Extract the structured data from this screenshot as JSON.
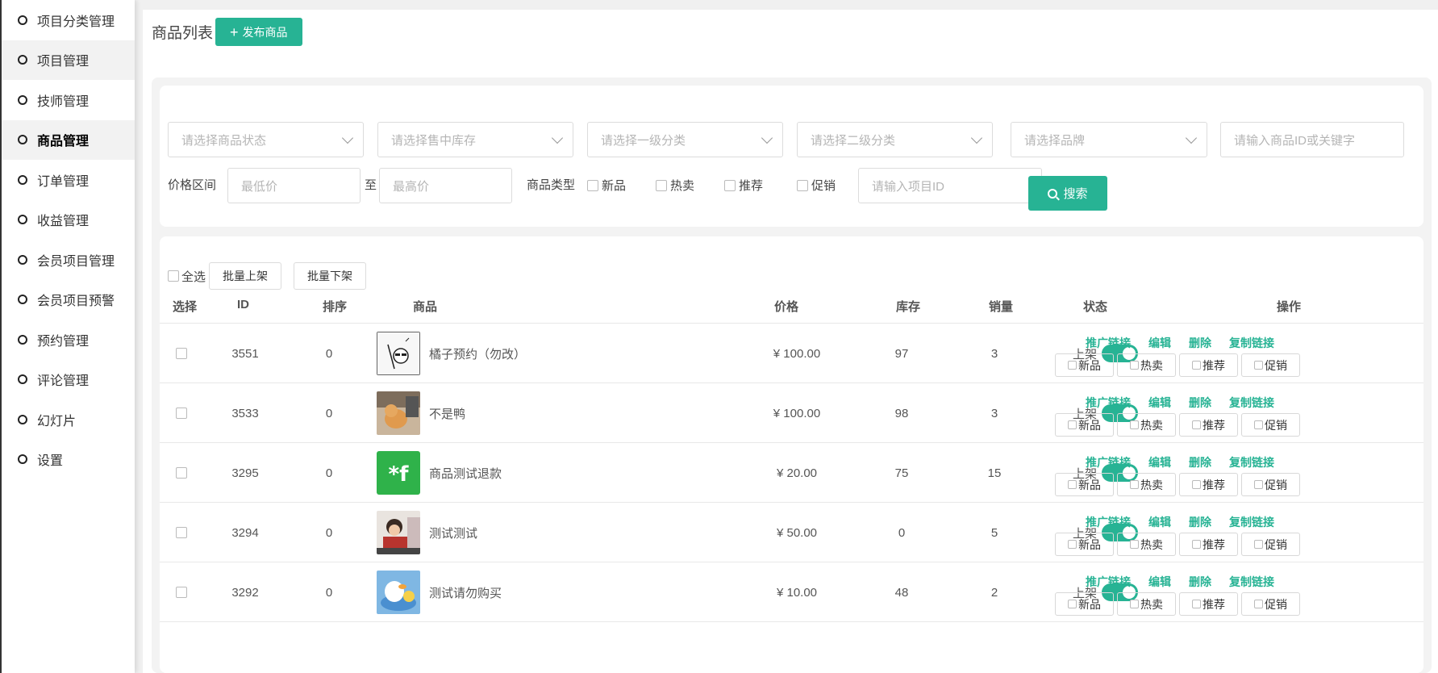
{
  "sidebar": {
    "items": [
      {
        "label": "项目分类管理"
      },
      {
        "label": "项目管理"
      },
      {
        "label": "技师管理"
      },
      {
        "label": "商品管理"
      },
      {
        "label": "订单管理"
      },
      {
        "label": "收益管理"
      },
      {
        "label": "会员项目管理"
      },
      {
        "label": "会员项目预警"
      },
      {
        "label": "预约管理"
      },
      {
        "label": "评论管理"
      },
      {
        "label": "幻灯片"
      },
      {
        "label": "设置"
      }
    ]
  },
  "header": {
    "title": "商品列表",
    "publish_label": "发布商品"
  },
  "filters": {
    "status_placeholder": "请选择商品状态",
    "stock_placeholder": "请选择售中库存",
    "cat1_placeholder": "请选择一级分类",
    "cat2_placeholder": "请选择二级分类",
    "brand_placeholder": "请选择品牌",
    "keyword_placeholder": "请输入商品ID或关键字",
    "price_label": "价格区间",
    "min_placeholder": "最低价",
    "to_label": "至",
    "max_placeholder": "最高价",
    "type_label": "商品类型",
    "type_options": [
      "新品",
      "热卖",
      "推荐",
      "促销"
    ],
    "project_placeholder": "请输入项目ID",
    "search_label": "搜索"
  },
  "bulk": {
    "select_all": "全选",
    "on_shelf": "批量上架",
    "off_shelf": "批量下架"
  },
  "table": {
    "headers": {
      "select": "选择",
      "id": "ID",
      "sort": "排序",
      "product": "商品",
      "price": "价格",
      "stock": "库存",
      "sales": "销量",
      "status": "状态",
      "ops": "操作"
    },
    "rows": [
      {
        "id": "3551",
        "sort": "0",
        "name": "橘子预约（勿改）",
        "price": "¥ 100.00",
        "stock": "97",
        "sales": "3",
        "status": "上架"
      },
      {
        "id": "3533",
        "sort": "0",
        "name": "不是鸭",
        "price": "¥ 100.00",
        "stock": "98",
        "sales": "3",
        "status": "上架"
      },
      {
        "id": "3295",
        "sort": "0",
        "name": "商品测试退款",
        "price": "¥ 20.00",
        "stock": "75",
        "sales": "15",
        "status": "上架"
      },
      {
        "id": "3294",
        "sort": "0",
        "name": "测试测试",
        "price": "¥ 50.00",
        "stock": "0",
        "sales": "5",
        "status": "上架"
      },
      {
        "id": "3292",
        "sort": "0",
        "name": "测试请勿购买",
        "price": "¥ 10.00",
        "stock": "48",
        "sales": "2",
        "status": "上架"
      }
    ],
    "op_links": {
      "promo": "推广链接",
      "edit": "编辑",
      "delete": "删除",
      "copy": "复制链接"
    },
    "tag_buttons": [
      "新品",
      "热卖",
      "推荐",
      "促销"
    ]
  },
  "colors": {
    "accent": "#27b394"
  }
}
